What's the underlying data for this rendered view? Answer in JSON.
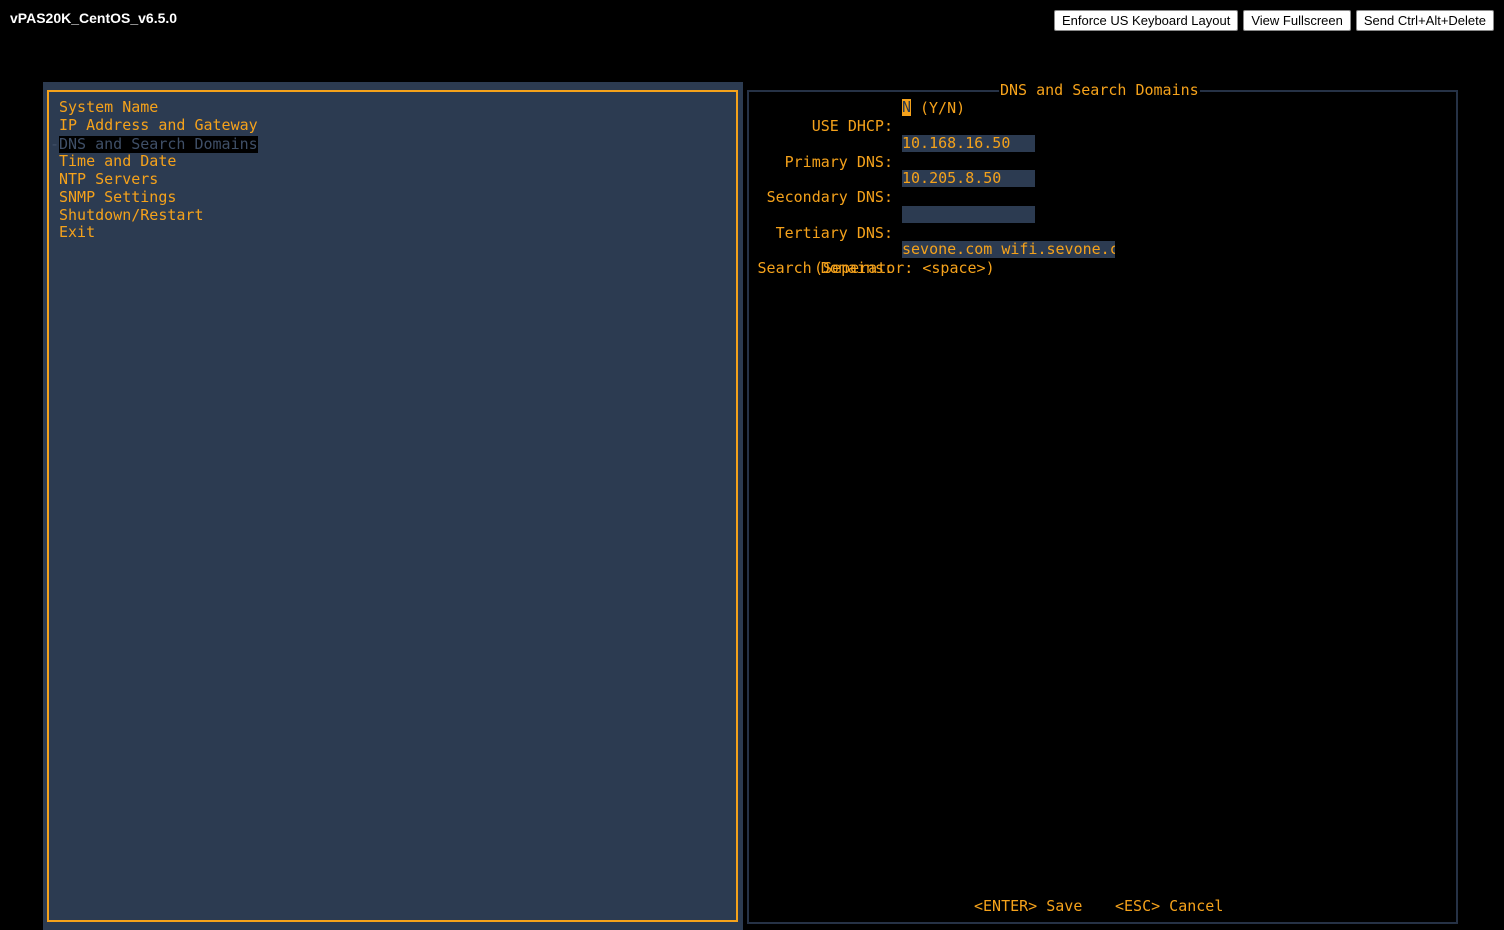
{
  "window": {
    "title": "vPAS20K_CentOS_v6.5.0"
  },
  "toolbar": {
    "keyboard_label": "Enforce US Keyboard Layout",
    "fullscreen_label": "View Fullscreen",
    "ctrl_alt_del_label": "Send Ctrl+Alt+Delete"
  },
  "menu": {
    "items": [
      {
        "label": "System Name"
      },
      {
        "label": "IP Address and Gateway"
      },
      {
        "label": "DNS and Search Domains",
        "selected": true
      },
      {
        "label": "Time and Date"
      },
      {
        "label": "NTP Servers"
      },
      {
        "label": "SNMP Settings"
      },
      {
        "label": "Shutdown/Restart"
      },
      {
        "label": "Exit"
      }
    ]
  },
  "panel": {
    "title": "DNS and Search Domains",
    "dhcp_label": "USE DHCP:",
    "dhcp_value": "N",
    "dhcp_hint": "(Y/N)",
    "primary_label": "Primary DNS:",
    "primary_value": "10.168.16.50",
    "secondary_label": "Secondary DNS:",
    "secondary_value": "10.205.8.50",
    "tertiary_label": "Tertiary DNS:",
    "tertiary_value": "",
    "search_label": "Search Domains:",
    "search_value": "sevone.com wifi.sevone.c",
    "separator_hint": "(Seperator: <space>)",
    "save_label": "<ENTER> Save",
    "cancel_label": "<ESC> Cancel"
  },
  "colors": {
    "background": "#000000",
    "panel_bg": "#2c3b51",
    "text_accent": "#f5a21b",
    "selected_text": "#3f4f67"
  }
}
